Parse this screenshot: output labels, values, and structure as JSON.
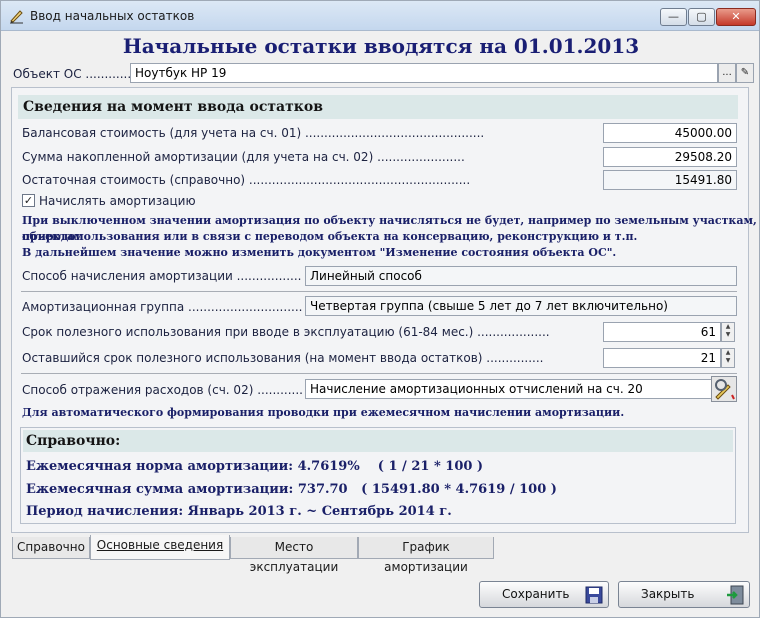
{
  "window": {
    "title": "Ввод начальных остатков",
    "min_label": "—",
    "max_label": "▢",
    "close_label": "✕"
  },
  "heading": "Начальные остатки вводятся на 01.01.2013",
  "asset": {
    "label": "Объект ОС ..................",
    "value": "Ноутбук HP 19",
    "select_glyph": "...",
    "open_glyph": "✎"
  },
  "section_title": "Сведения на момент ввода остатков",
  "balance": {
    "label": "Балансовая стоимость (для учета на сч. 01) ...............................................",
    "value": "45000.00"
  },
  "accum": {
    "label": "Сумма накопленной амортизации (для учета на сч. 02) .......................",
    "value": "29508.20"
  },
  "residual": {
    "label": "Остаточная стоимость (справочно) ..........................................................",
    "value": "15491.80"
  },
  "accrue_checkbox": {
    "label": "Начислять амортизацию",
    "checked": true,
    "mark": "✓"
  },
  "note_lines": [
    "При выключенном значении амортизация по объекту начисляться не будет, например по земельным участкам, объектам",
    "природопользования или в связи с переводом объекта на консервацию, реконструкцию и т.п.",
    "В дальнейшем значение можно изменить документом \"Изменение состояния объекта ОС\"."
  ],
  "method": {
    "label": "Способ начисления амортизации ...............................................",
    "value": "Линейный способ"
  },
  "group": {
    "label": "Амортизационная группа ...............................................................",
    "value": "Четвертая группа (свыше 5 лет до 7 лет включительно)"
  },
  "useful_life": {
    "label": "Срок полезного использования при вводе в эксплуатацию (61-84 мес.) ...................",
    "value": "61"
  },
  "remaining_life": {
    "label": "Оставшийся срок полезного использования (на момент ввода остатков) ...............",
    "value": "21"
  },
  "expense": {
    "label": "Способ отражения расходов (сч. 02) ......................................",
    "value": "Начисление амортизационных отчислений на сч. 20"
  },
  "expense_note": "Для автоматического формирования проводки при ежемесячном начислении амортизации.",
  "reference": {
    "title": "Справочно:",
    "lines": [
      "Ежемесячная норма амортизации: 4.7619%    ( 1 / 21 * 100 )",
      "Ежемесячная сумма амортизации: 737.70   ( 15491.80 * 4.7619 / 100 )",
      "Период начисления: Январь 2013 г. ~ Сентябрь 2014 г."
    ]
  },
  "tabs": [
    "Справочно",
    "Основные сведения",
    "Место эксплуатации",
    "График амортизации"
  ],
  "active_tab": 1,
  "buttons": {
    "save": "Сохранить",
    "close": "Закрыть"
  },
  "colors": {
    "heading": "#1a1f74",
    "note": "#1a2068",
    "section_bg": "#dbe8e8"
  }
}
